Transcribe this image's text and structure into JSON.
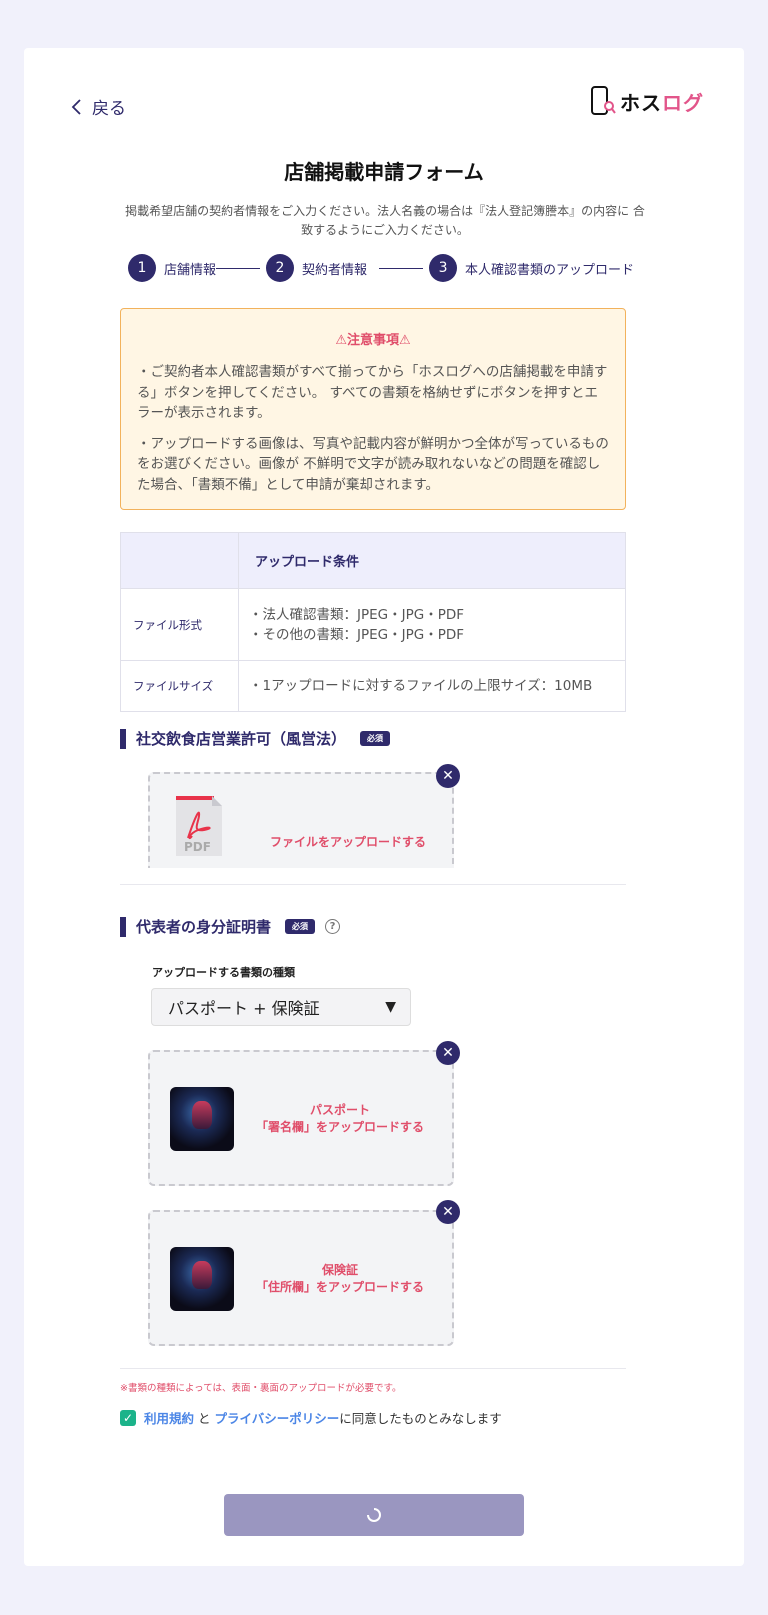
{
  "header": {
    "back_label": "戻る",
    "logo_main": "ホス",
    "logo_accent": "ログ"
  },
  "form": {
    "title": "店舗掲載申請フォーム",
    "subtitle": "掲載希望店舗の契約者情報をご入力ください。法人名義の場合は『法人登記簿謄本』の内容に 合致するようにご入力ください。"
  },
  "steps": [
    {
      "num": "1",
      "label": "店舗情報"
    },
    {
      "num": "2",
      "label": "契約者情報"
    },
    {
      "num": "3",
      "label": "本人確認書類のアップロード"
    }
  ],
  "notice": {
    "title": "⚠注意事項⚠",
    "p1": "・ご契約者本人確認書類がすべて揃ってから「ホスログへの店舗掲載を申請する」ボタンを押してください。 すべての書類を格納せずにボタンを押すとエラーが表示されます。",
    "p2": "・アップロードする画像は、写真や記載内容が鮮明かつ全体が写っているものをお選びください。画像が 不鮮明で文字が読み取れないなどの問題を確認した場合、「書類不備」として申請が棄却されます。"
  },
  "conditions": {
    "header": "アップロード条件",
    "rows": [
      {
        "label": "ファイル形式",
        "line1": "・法人確認書類：JPEG・JPG・PDF",
        "line2": "・その他の書類：JPEG・JPG・PDF"
      },
      {
        "label": "ファイルサイズ",
        "line1": "・1アップロードに対するファイルの上限サイズ：10MB"
      }
    ]
  },
  "section1": {
    "title": "社交飲食店営業許可（風営法）",
    "badge": "必須",
    "pdf_label": "PDF",
    "upload_text": "ファイルをアップロードする"
  },
  "section2": {
    "title": "代表者の身分証明書",
    "badge": "必須",
    "help": "?",
    "select_label": "アップロードする書類の種類",
    "select_value": "パスポート + 保険証",
    "upload1_line1": "パスポート",
    "upload1_line2": "「署名欄」をアップロードする",
    "upload2_line1": "保険証",
    "upload2_line2": "「住所欄」をアップロードする"
  },
  "footer": {
    "note": "※書類の種類によっては、表面・裏面のアップロードが必要です。",
    "terms_link": "利用規約",
    "and": " と ",
    "privacy_link": "プライバシーポリシー",
    "agree_suffix": "に同意したものとみなします"
  },
  "colors": {
    "primary": "#2f2a6b",
    "accent_red": "#e04e6a",
    "link_blue": "#4c86e6",
    "check_green": "#1bb38a",
    "logo_pink": "#e2558a"
  }
}
